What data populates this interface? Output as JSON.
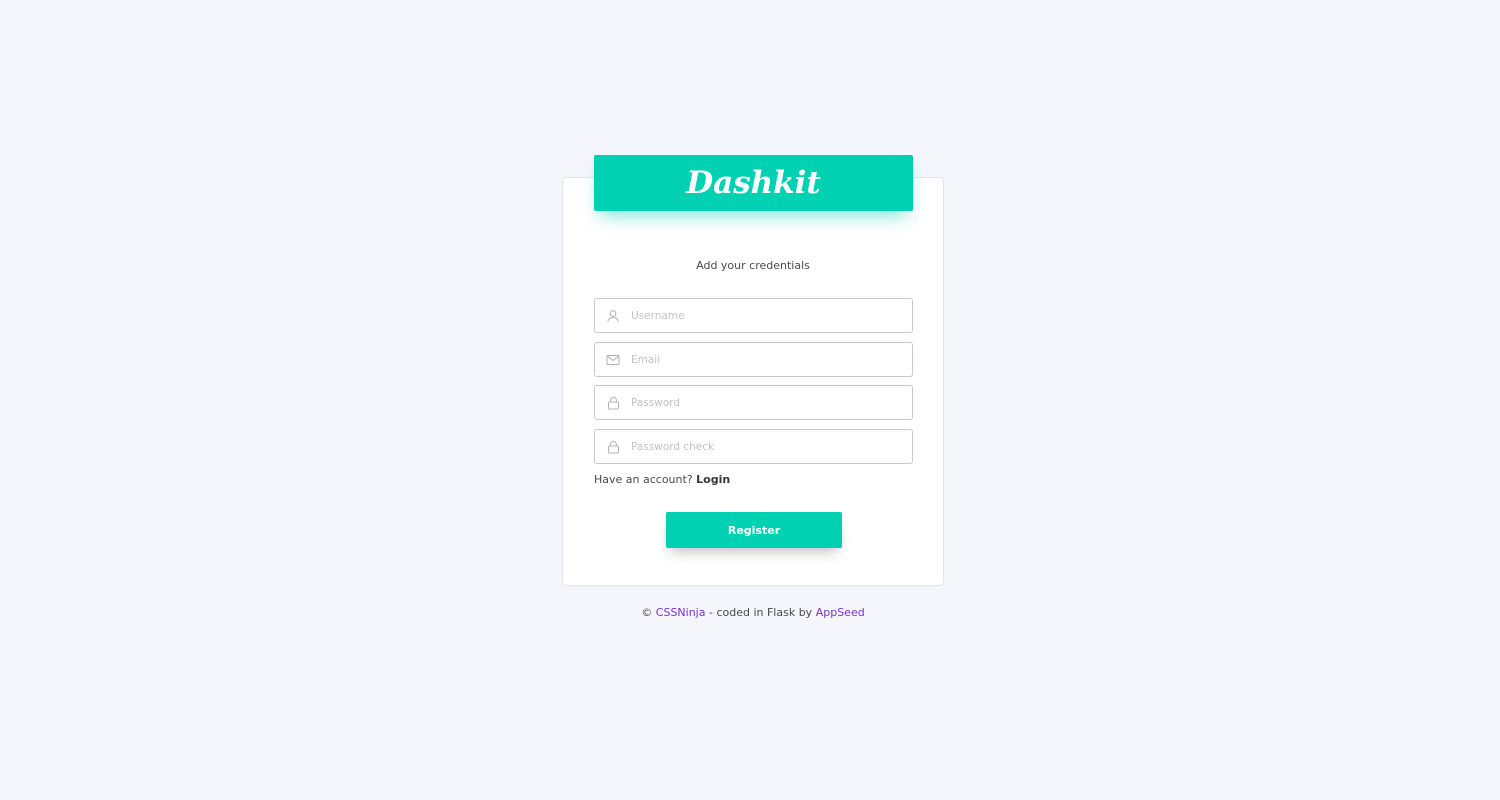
{
  "brand": {
    "name": "Dashkit",
    "color": "#00d1b2"
  },
  "form": {
    "subtitle": "Add your credentials",
    "fields": {
      "username": {
        "placeholder": "Username",
        "value": "",
        "icon": "user-icon"
      },
      "email": {
        "placeholder": "Email",
        "value": "",
        "icon": "envelope-icon"
      },
      "password": {
        "placeholder": "Password",
        "value": "",
        "icon": "lock-icon"
      },
      "password_check": {
        "placeholder": "Password check",
        "value": "",
        "icon": "lock-icon"
      }
    },
    "account_prompt": "Have an account?",
    "login_label": "Login",
    "register_label": "Register"
  },
  "footer": {
    "copyright": "©",
    "author_link": "CSSNinja",
    "middle_text": "- coded in Flask by",
    "appseed_link": "AppSeed",
    "link_color": "#7a2fd6"
  }
}
